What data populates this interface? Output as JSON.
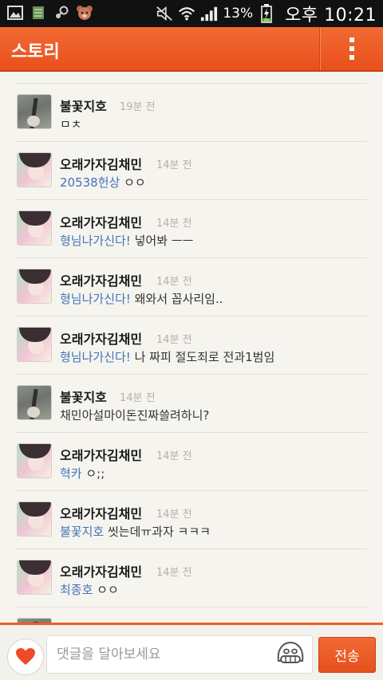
{
  "statusbar": {
    "battery_percent": "13%",
    "time": "오후 10:21",
    "icons": [
      "image-icon",
      "sd-card-icon",
      "steam-icon",
      "bear-icon",
      "mute-icon",
      "wifi-icon",
      "signal-icon",
      "battery-charging-icon"
    ]
  },
  "header": {
    "title": "스토리",
    "menu_icon": "overflow-menu-icon",
    "accent": "#ef5d24"
  },
  "comments": [
    {
      "author": "불꽃지호",
      "time": "19분 전",
      "mention": "",
      "text": "ㅁㅊ",
      "avatar": "guitar"
    },
    {
      "author": "오래가자김채민",
      "time": "14분 전",
      "mention": "20538헌상",
      "text": " ㅇㅇ",
      "avatar": "girl"
    },
    {
      "author": "오래가자김채민",
      "time": "14분 전",
      "mention": "형님나가신다!",
      "text": " 넣어봐 ㅡㅡ",
      "avatar": "girl"
    },
    {
      "author": "오래가자김채민",
      "time": "14분 전",
      "mention": "형님나가신다!",
      "text": " 왜와서 꼽사리임..",
      "avatar": "girl"
    },
    {
      "author": "오래가자김채민",
      "time": "14분 전",
      "mention": "형님나가신다!",
      "text": " 나 짜피 절도죄로 전과1범임",
      "avatar": "girl"
    },
    {
      "author": "불꽃지호",
      "time": "14분 전",
      "mention": "",
      "text": "채민아설마이돈진짜쓸려하니?",
      "avatar": "guitar"
    },
    {
      "author": "오래가자김채민",
      "time": "14분 전",
      "mention": "혁카",
      "text": " ㅇ;;",
      "avatar": "girl"
    },
    {
      "author": "오래가자김채민",
      "time": "14분 전",
      "mention": "불꽃지호",
      "text": " 씻는데ㅠ과자 ㅋㅋㅋ",
      "avatar": "girl"
    },
    {
      "author": "오래가자김채민",
      "time": "14분 전",
      "mention": "최종호",
      "text": " ㅇㅇ",
      "avatar": "girl"
    }
  ],
  "input": {
    "placeholder": "댓글을 달아보세요",
    "value": "",
    "send_label": "전송",
    "like_icon": "heart-icon",
    "emoticon_icon": "emoticon-icon"
  },
  "colors": {
    "mention": "#3f74b8",
    "heart": "#ef4b2b"
  }
}
